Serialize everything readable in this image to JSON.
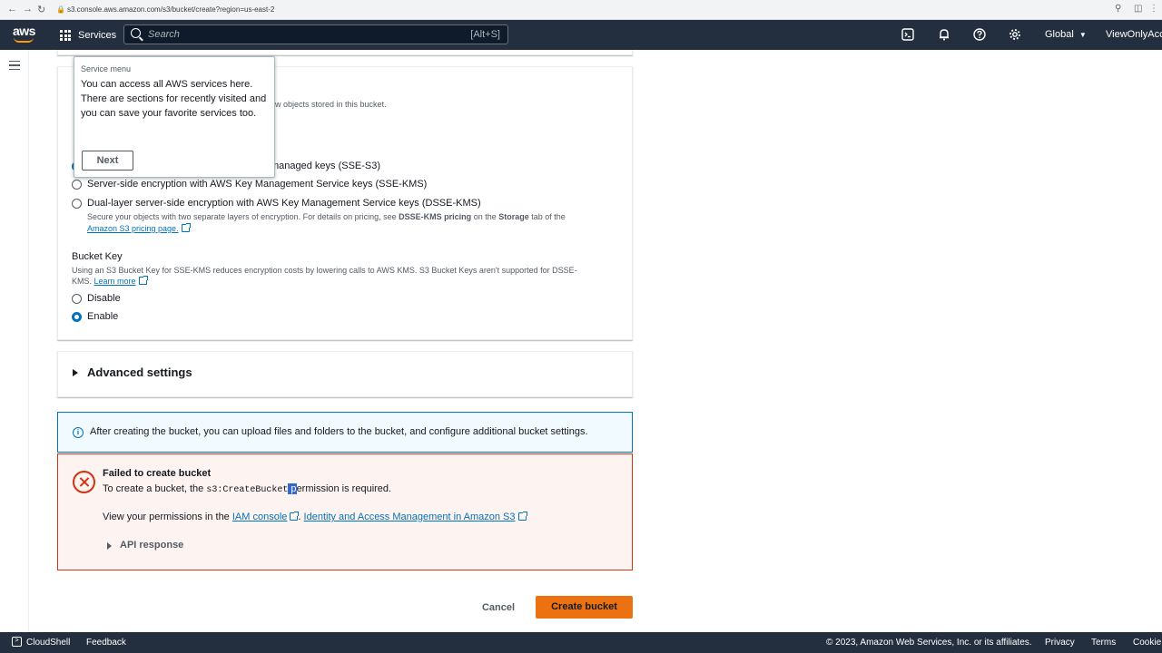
{
  "browser": {
    "url": "s3.console.aws.amazon.com/s3/bucket/create?region=us-east-2"
  },
  "topnav": {
    "services_label": "Services",
    "search_placeholder": "Search",
    "search_shortcut": "[Alt+S]",
    "region": "Global",
    "user": "ViewOnlyAcce"
  },
  "popover": {
    "heading": "Service menu",
    "body": "You can access all AWS services here. There are sections for recently visited and you can save your favorite services too.",
    "next_label": "Next"
  },
  "encryption": {
    "partial_desc": "ew objects stored in this bucket.",
    "options": [
      {
        "label": "managed keys (SSE-S3)",
        "selected": true
      },
      {
        "label": "Server-side encryption with AWS Key Management Service keys (SSE-KMS)",
        "selected": false
      },
      {
        "label": "Dual-layer server-side encryption with AWS Key Management Service keys (DSSE-KMS)",
        "selected": false
      }
    ],
    "dsse_desc_prefix": "Secure your objects with two separate layers of encryption. For details on pricing, see ",
    "dsse_desc_bold1": "DSSE-KMS pricing",
    "dsse_desc_mid": " on the ",
    "dsse_desc_bold2": "Storage",
    "dsse_desc_suffix": " tab of the",
    "pricing_link": "Amazon S3 pricing page."
  },
  "bucket_key": {
    "title": "Bucket Key",
    "desc_line1": "Using an S3 Bucket Key for SSE-KMS reduces encryption costs by lowering calls to AWS KMS. S3 Bucket Keys aren't supported for DSSE-",
    "desc_line2": "KMS.",
    "learn_more": "Learn more",
    "options": [
      {
        "label": "Disable",
        "selected": false
      },
      {
        "label": "Enable",
        "selected": true
      }
    ]
  },
  "advanced": {
    "title": "Advanced settings"
  },
  "info_alert": {
    "text": "After creating the bucket, you can upload files and folders to the bucket, and configure additional bucket settings."
  },
  "error_alert": {
    "title": "Failed to create bucket",
    "body_prefix": "To create a bucket, the ",
    "permission_code_a": "s3:CreateBucket",
    "permission_sel": " p",
    "body_suffix": "ermission is required.",
    "perm_prefix": "View your permissions in the ",
    "iam_link": "IAM console",
    "perm_sep": ".",
    "iam_s3_link": "Identity and Access Management in Amazon S3",
    "api_response": "API response"
  },
  "actions": {
    "cancel": "Cancel",
    "create": "Create bucket"
  },
  "footer": {
    "cloudshell": "CloudShell",
    "feedback": "Feedback",
    "copyright": "© 2023, Amazon Web Services, Inc. or its affiliates.",
    "privacy": "Privacy",
    "terms": "Terms",
    "cookie": "Cookie"
  }
}
